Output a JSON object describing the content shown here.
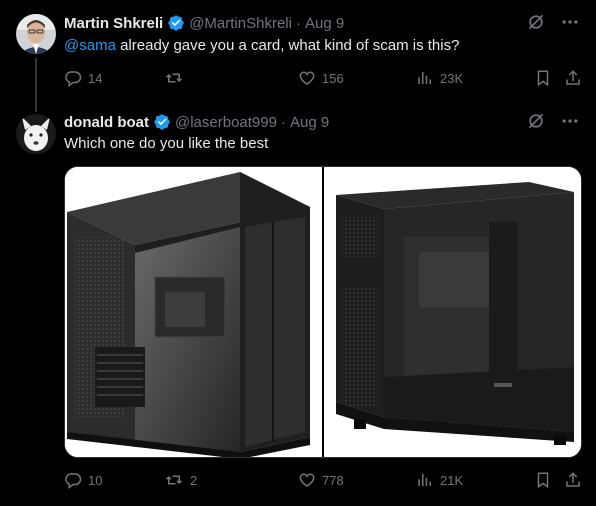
{
  "tweets": [
    {
      "name": "Martin Shkreli",
      "handle": "@MartinShkreli",
      "dot": "·",
      "date": "Aug 9",
      "mention": "@sama",
      "text": " already gave you a card, what kind of scam is this?",
      "replies": "14",
      "retweets": "",
      "likes": "156",
      "views": "23K"
    },
    {
      "name": "donald boat",
      "handle": "@laserboat999",
      "dot": "·",
      "date": "Aug 9",
      "mention": "",
      "text": "Which one do you like the best",
      "replies": "10",
      "retweets": "2",
      "likes": "778",
      "views": "21K"
    }
  ],
  "icons": {
    "verified": "verified-badge-icon",
    "grok": "grok-icon",
    "more": "more-icon",
    "reply": "reply-icon",
    "retweet": "retweet-icon",
    "like": "like-icon",
    "views": "views-icon",
    "bookmark": "bookmark-icon",
    "share": "share-icon"
  },
  "colors": {
    "background": "#000000",
    "text": "#e7e9ea",
    "muted": "#71767b",
    "accent": "#1d9bf0",
    "verified": "#1d9bf0"
  }
}
